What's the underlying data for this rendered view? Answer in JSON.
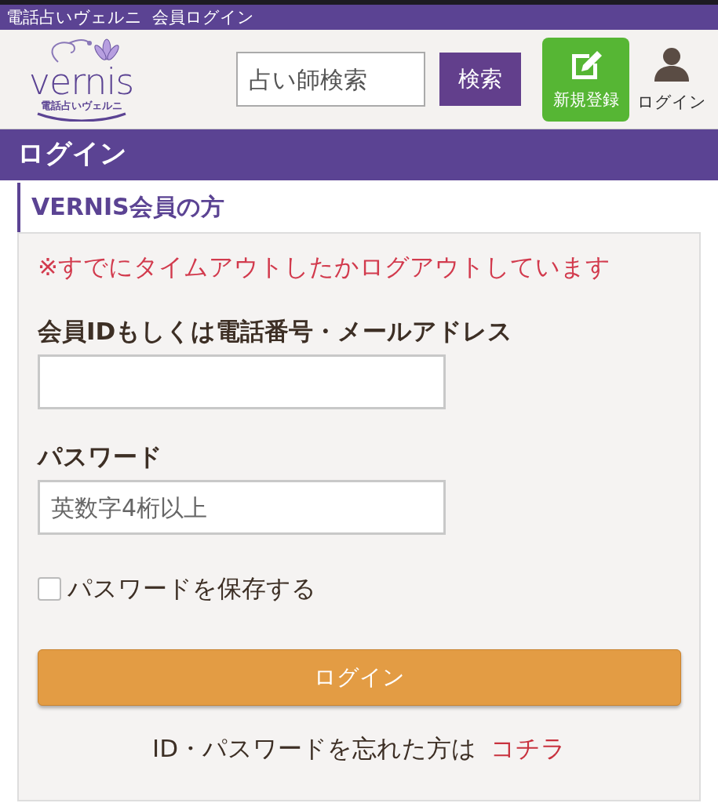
{
  "window": {
    "title": "電話占いヴェルニ  会員ログイン"
  },
  "header": {
    "logo": {
      "wordmark": "vernis",
      "subtitle": "電話占いヴェルニ"
    },
    "search": {
      "placeholder": "占い師検索",
      "button": "検索"
    },
    "register": "新規登録",
    "login": "ログイン"
  },
  "page_title": "ログイン",
  "section_title": "VERNIS会員の方",
  "form": {
    "notice": "※すでにタイムアウトしたかログアウトしています",
    "fields": [
      {
        "label": "会員IDもしくは電話番号・メールアドレス"
      },
      {
        "label": "パスワード",
        "placeholder": "英数字4桁以上"
      }
    ],
    "remember": {
      "label": "パスワードを保存する",
      "checked": false
    },
    "submit": "ログイン",
    "forgot": {
      "text": "ID・パスワードを忘れた方は",
      "link": "コチラ"
    }
  }
}
